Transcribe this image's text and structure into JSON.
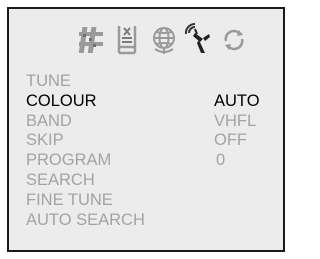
{
  "icons": [
    {
      "name": "picture-settings-icon"
    },
    {
      "name": "sound-settings-icon"
    },
    {
      "name": "language-globe-icon"
    },
    {
      "name": "channel-tuning-antenna-icon"
    },
    {
      "name": "refresh-function-icon"
    }
  ],
  "menu": {
    "items": [
      {
        "label": "TUNE",
        "value": ""
      },
      {
        "label": "COLOUR",
        "value": "AUTO",
        "active": true
      },
      {
        "label": "BAND",
        "value": "VHFL"
      },
      {
        "label": "SKIP",
        "value": "OFF"
      },
      {
        "label": "PROGRAM",
        "value": "0"
      },
      {
        "label": "SEARCH",
        "value": ""
      },
      {
        "label": "FINE TUNE",
        "value": ""
      },
      {
        "label": "AUTO SEARCH",
        "value": ""
      }
    ]
  },
  "colors": {
    "active_text": "#000000",
    "inactive_text": "#a3a3a3",
    "panel_background": "#ececec",
    "panel_border": "#1a1a1a"
  }
}
